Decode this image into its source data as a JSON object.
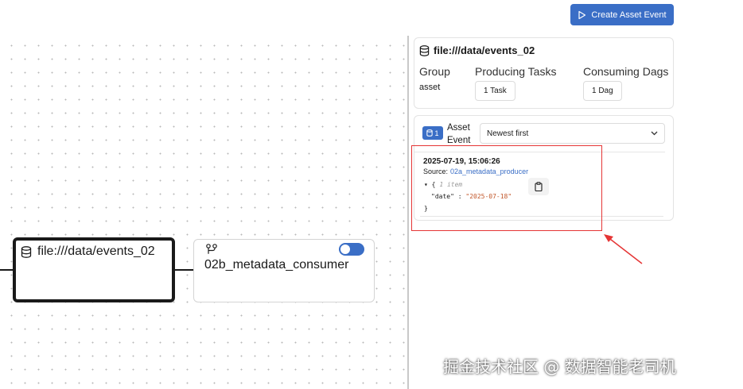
{
  "toolbar": {
    "create_label": "Create Asset Event"
  },
  "graph": {
    "asset_node": {
      "label": "file:///data/events_02"
    },
    "dag_node": {
      "label": "02b_metadata_consumer",
      "toggle_on": true
    }
  },
  "details": {
    "title": "file:///data/events_02",
    "group": {
      "heading": "Group",
      "value": "asset"
    },
    "producing": {
      "heading": "Producing Tasks",
      "value": "1 Task"
    },
    "consuming": {
      "heading": "Consuming Dags",
      "value": "1 Dag"
    }
  },
  "events": {
    "count": "1",
    "label_line1": "Asset",
    "label_line2": "Event",
    "sort_selected": "Newest first",
    "items": [
      {
        "timestamp": "2025-07-19, 15:06:26",
        "source_label": "Source:",
        "source": "02a_metadata_producer",
        "extra_open": "{",
        "extra_count": "1 item",
        "key": "\"date\"",
        "colon": ":",
        "value": "\"2025-07-18\"",
        "extra_close": "}"
      }
    ]
  },
  "watermark": "掘金技术社区 @ 数据智能老司机",
  "colors": {
    "accent": "#3a6ec6",
    "highlight": "#e53535"
  }
}
